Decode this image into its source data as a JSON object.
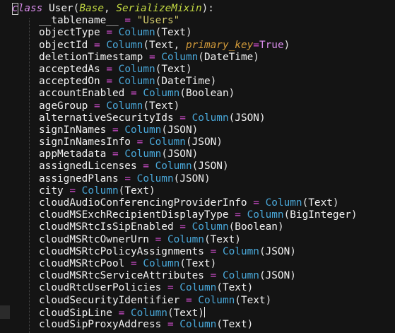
{
  "editor": {
    "header": {
      "keyword": "class",
      "class_name": "User",
      "bases": [
        "Base",
        "SerializeMixin"
      ]
    },
    "tablename": {
      "name": "__tablename__",
      "value": "\"Users\""
    },
    "columns": [
      {
        "name": "objectType",
        "type": "Text"
      },
      {
        "name": "objectId",
        "type": "Text",
        "kwarg": "primary_key",
        "kwarg_value": "True"
      },
      {
        "name": "deletionTimestamp",
        "type": "DateTime"
      },
      {
        "name": "acceptedAs",
        "type": "Text"
      },
      {
        "name": "acceptedOn",
        "type": "DateTime"
      },
      {
        "name": "accountEnabled",
        "type": "Boolean"
      },
      {
        "name": "ageGroup",
        "type": "Text"
      },
      {
        "name": "alternativeSecurityIds",
        "type": "JSON"
      },
      {
        "name": "signInNames",
        "type": "JSON"
      },
      {
        "name": "signInNamesInfo",
        "type": "JSON"
      },
      {
        "name": "appMetadata",
        "type": "JSON"
      },
      {
        "name": "assignedLicenses",
        "type": "JSON"
      },
      {
        "name": "assignedPlans",
        "type": "JSON"
      },
      {
        "name": "city",
        "type": "Text"
      },
      {
        "name": "cloudAudioConferencingProviderInfo",
        "type": "Text"
      },
      {
        "name": "cloudMSExchRecipientDisplayType",
        "type": "BigInteger"
      },
      {
        "name": "cloudMSRtcIsSipEnabled",
        "type": "Boolean"
      },
      {
        "name": "cloudMSRtcOwnerUrn",
        "type": "Text"
      },
      {
        "name": "cloudMSRtcPolicyAssignments",
        "type": "JSON"
      },
      {
        "name": "cloudMSRtcPool",
        "type": "Text"
      },
      {
        "name": "cloudMSRtcServiceAttributes",
        "type": "JSON"
      },
      {
        "name": "cloudRtcUserPolicies",
        "type": "Text"
      },
      {
        "name": "cloudSecurityIdentifier",
        "type": "Text"
      },
      {
        "name": "cloudSipLine",
        "type": "Text",
        "has_caret": true
      },
      {
        "name": "cloudSipProxyAddress",
        "type": "Text"
      }
    ],
    "tokens": {
      "assign": "=",
      "column_fn": "Column",
      "open_paren": "(",
      "close_paren": ")",
      "comma": ",",
      "colon": ":"
    }
  }
}
